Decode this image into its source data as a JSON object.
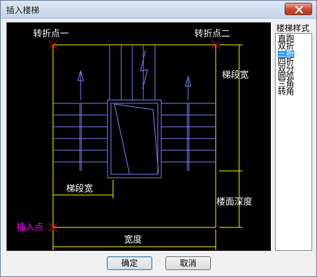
{
  "window": {
    "title": "插入楼梯",
    "close_icon": "close-icon"
  },
  "preview": {
    "labels": {
      "turn_point_1": "转折点一",
      "turn_point_2": "转折点二",
      "flight_width_right": "梯段宽",
      "flight_width_bottom": "梯段宽",
      "landing_depth": "楼面深度",
      "insert_point": "插入点",
      "width": "宽度"
    },
    "colors": {
      "background": "#000000",
      "outline": "#ffff00",
      "stair": "#8080ff",
      "text": "#ffffff",
      "marker": "#ff0000",
      "insert_label": "#ff00ff"
    }
  },
  "style_panel": {
    "label": "楼梯样式",
    "items": [
      "直跑",
      "双折",
      "三折",
      "四折",
      "双分",
      "圆弧",
      "三角",
      "转角"
    ],
    "selected": "三折"
  },
  "buttons": {
    "ok": "确定",
    "cancel": "取消"
  }
}
